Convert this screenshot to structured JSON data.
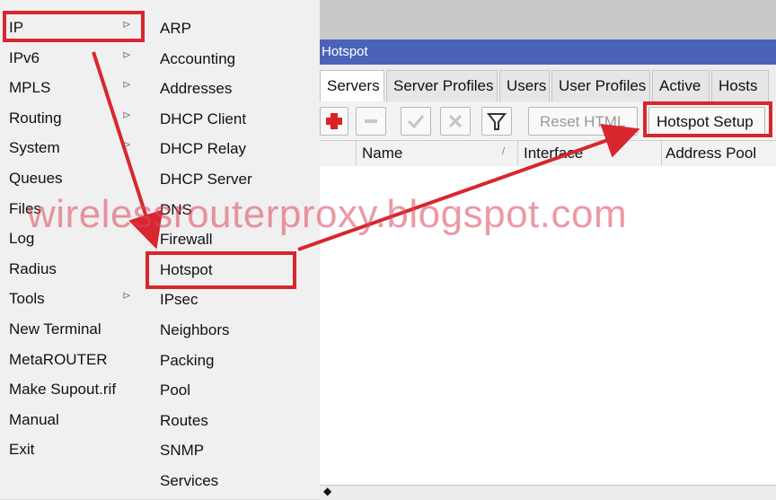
{
  "left_menu": {
    "items": [
      {
        "label": "IP",
        "arrow": true
      },
      {
        "label": "IPv6",
        "arrow": true
      },
      {
        "label": "MPLS",
        "arrow": true
      },
      {
        "label": "Routing",
        "arrow": true
      },
      {
        "label": "System",
        "arrow": true
      },
      {
        "label": "Queues",
        "arrow": false
      },
      {
        "label": "Files",
        "arrow": false
      },
      {
        "label": "Log",
        "arrow": false
      },
      {
        "label": "Radius",
        "arrow": false
      },
      {
        "label": "Tools",
        "arrow": true
      },
      {
        "label": "New Terminal",
        "arrow": false
      },
      {
        "label": "MetaROUTER",
        "arrow": false
      },
      {
        "label": "Make Supout.rif",
        "arrow": false
      },
      {
        "label": "Manual",
        "arrow": false
      },
      {
        "label": "Exit",
        "arrow": false
      }
    ]
  },
  "sub_menu": {
    "items": [
      {
        "label": "ARP"
      },
      {
        "label": "Accounting"
      },
      {
        "label": "Addresses"
      },
      {
        "label": "DHCP Client"
      },
      {
        "label": "DHCP Relay"
      },
      {
        "label": "DHCP Server"
      },
      {
        "label": "DNS"
      },
      {
        "label": "Firewall"
      },
      {
        "label": "Hotspot"
      },
      {
        "label": "IPsec"
      },
      {
        "label": "Neighbors"
      },
      {
        "label": "Packing"
      },
      {
        "label": "Pool"
      },
      {
        "label": "Routes"
      },
      {
        "label": "SNMP"
      },
      {
        "label": "Services"
      }
    ]
  },
  "window": {
    "title": "Hotspot",
    "tabs": [
      {
        "label": "Servers"
      },
      {
        "label": "Server Profiles"
      },
      {
        "label": "Users"
      },
      {
        "label": "User Profiles"
      },
      {
        "label": "Active"
      },
      {
        "label": "Hosts"
      }
    ],
    "toolbar": {
      "add_icon": "plus-icon",
      "remove_icon": "minus-icon",
      "enable_icon": "check-icon",
      "disable_icon": "cross-icon",
      "filter_icon": "filter-icon",
      "reset_html": "Reset HTML",
      "hotspot_setup": "Hotspot Setup"
    },
    "columns": [
      "Name",
      "Interface",
      "Address Pool"
    ]
  },
  "watermark": "wirelessrouterproxy.blogspot.com",
  "colors": {
    "highlight": "#d8262f",
    "titlebar": "#4a63b8"
  }
}
